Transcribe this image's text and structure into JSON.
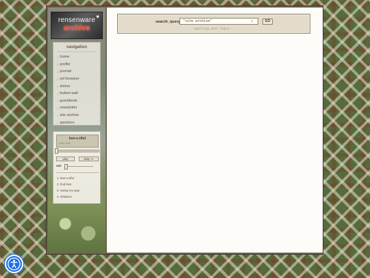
{
  "logo": {
    "line1": "rensenware",
    "line2": "archive",
    "heart": "♥"
  },
  "navigation": {
    "title": "navigation",
    "items": [
      "home",
      "profile",
      "journal",
      "sel browser",
      "shrine",
      "button wall",
      "guestbook",
      "newsletter",
      "site archive",
      "spindron"
    ]
  },
  "player": {
    "now_playing": "bee-u-tiful",
    "time": "0:00 / 4:07",
    "play_label": "play",
    "skip_label": "skip >>",
    "volume_label": "vol:",
    "volume_level": 0.05,
    "track_progress": 0.0,
    "playlist": [
      "1. bee-u-tiful",
      "2. find kiss",
      "3. swing my way",
      "4. distance"
    ]
  },
  "search": {
    "label": "search_query:",
    "value": "\"site archive\"",
    "go_label": "GO",
    "status": "awaiting user input..."
  },
  "icons": {
    "accessibility": "accessibility-icon",
    "key": "key-icon"
  },
  "colors": {
    "accent": "#1f6fe5",
    "panel": "#e4dccb",
    "frame": "#6e6253"
  }
}
